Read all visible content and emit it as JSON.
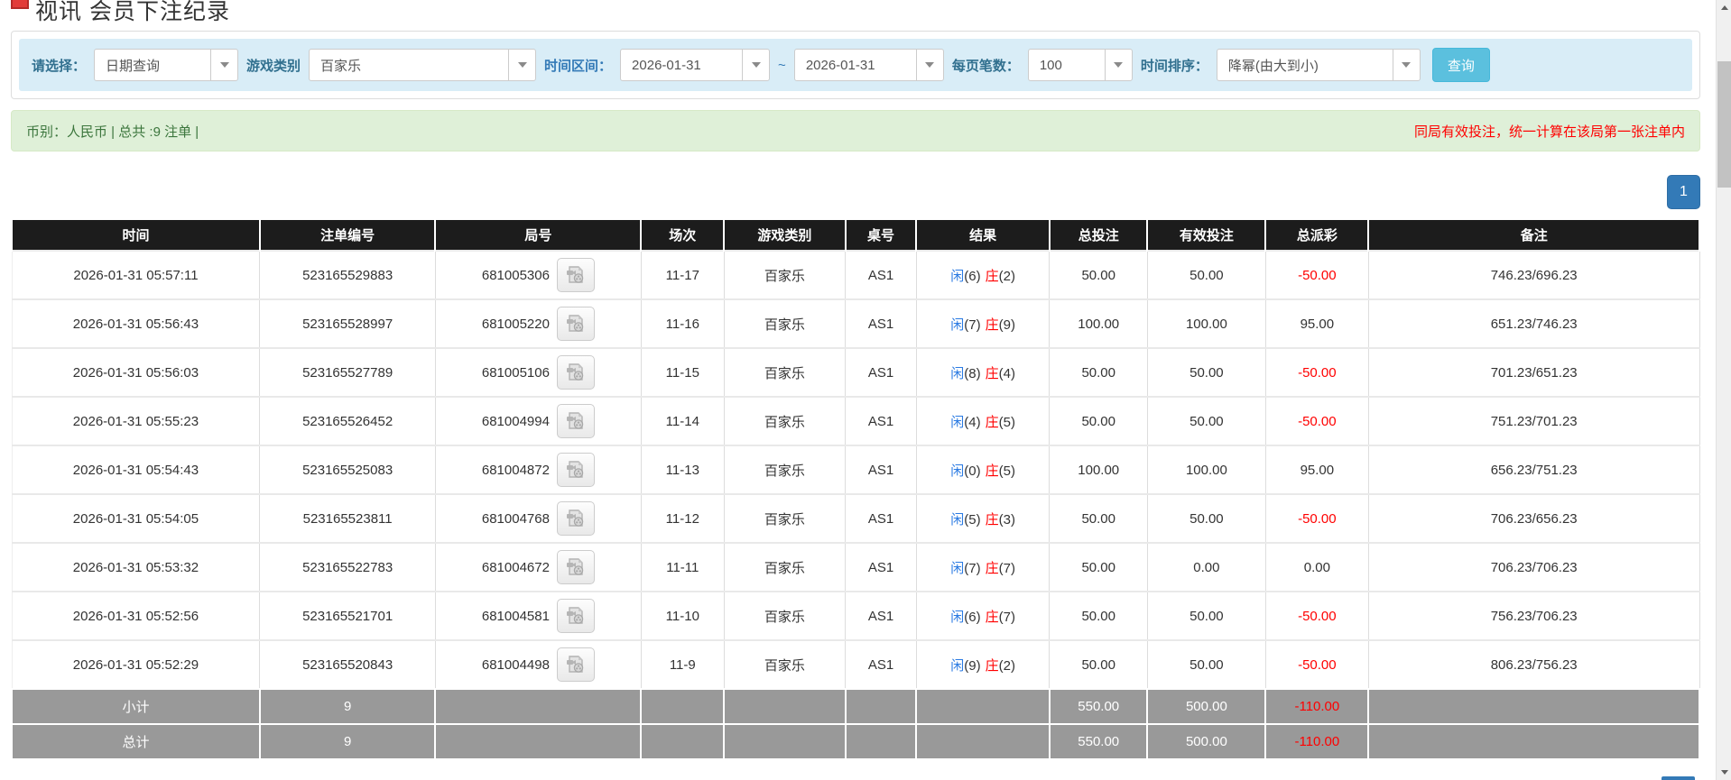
{
  "page": {
    "title": "视讯 会员下注纪录"
  },
  "icons": {
    "top_left": "red-chip-icon",
    "dropdown": "chevron-down-icon",
    "video": "video-replay-icon",
    "scroll_up": "scroll-up-arrow-icon",
    "scroll_down": "scroll-down-arrow-icon"
  },
  "colors": {
    "filter_bar_bg": "#d9edf7",
    "summary_bg": "#dff0d8",
    "summary_text": "#3c763d",
    "note_red": "#ff0000",
    "header_bg": "#1c1c1c",
    "link_blue": "#2a7ae2",
    "accent_blue": "#337ab7",
    "query_btn": "#5bc0de",
    "totals_gray": "#999999"
  },
  "filters": {
    "select_label": "请选择：",
    "select_value": "日期查询",
    "game_label": "游戏类别",
    "game_value": "百家乐",
    "range_label": "时间区间：",
    "date_from": "2026-01-31",
    "range_separator": "~",
    "date_to": "2026-01-31",
    "page_size_label": "每页笔数：",
    "page_size_value": "100",
    "sort_label": "时间排序：",
    "sort_value": "降幂(由大到小)",
    "query_button": "查询"
  },
  "summary": {
    "left": "币别：人民币 | 总共 :9 注单 |",
    "right_note": "同局有效投注，统一计算在该局第一张注单内"
  },
  "pagination": {
    "current": "1"
  },
  "table": {
    "headers": [
      "时间",
      "注单编号",
      "局号",
      "场次",
      "游戏类别",
      "桌号",
      "结果",
      "总投注",
      "有效投注",
      "总派彩",
      "备注"
    ],
    "rows": [
      {
        "time": "2026-01-31 05:57:11",
        "bet_id": "523165529883",
        "round_id": "681005306",
        "session": "11-17",
        "game": "百家乐",
        "table_no": "AS1",
        "result": {
          "player": "闲",
          "player_n": "(6)",
          "banker": "庄",
          "banker_n": "(2)"
        },
        "total_bet": "50.00",
        "valid_bet": "50.00",
        "payout": "-50.00",
        "note": "746.23/696.23"
      },
      {
        "time": "2026-01-31 05:56:43",
        "bet_id": "523165528997",
        "round_id": "681005220",
        "session": "11-16",
        "game": "百家乐",
        "table_no": "AS1",
        "result": {
          "player": "闲",
          "player_n": "(7)",
          "banker": "庄",
          "banker_n": "(9)"
        },
        "total_bet": "100.00",
        "valid_bet": "100.00",
        "payout": "95.00",
        "note": "651.23/746.23"
      },
      {
        "time": "2026-01-31 05:56:03",
        "bet_id": "523165527789",
        "round_id": "681005106",
        "session": "11-15",
        "game": "百家乐",
        "table_no": "AS1",
        "result": {
          "player": "闲",
          "player_n": "(8)",
          "banker": "庄",
          "banker_n": "(4)"
        },
        "total_bet": "50.00",
        "valid_bet": "50.00",
        "payout": "-50.00",
        "note": "701.23/651.23"
      },
      {
        "time": "2026-01-31 05:55:23",
        "bet_id": "523165526452",
        "round_id": "681004994",
        "session": "11-14",
        "game": "百家乐",
        "table_no": "AS1",
        "result": {
          "player": "闲",
          "player_n": "(4)",
          "banker": "庄",
          "banker_n": "(5)"
        },
        "total_bet": "50.00",
        "valid_bet": "50.00",
        "payout": "-50.00",
        "note": "751.23/701.23"
      },
      {
        "time": "2026-01-31 05:54:43",
        "bet_id": "523165525083",
        "round_id": "681004872",
        "session": "11-13",
        "game": "百家乐",
        "table_no": "AS1",
        "result": {
          "player": "闲",
          "player_n": "(0)",
          "banker": "庄",
          "banker_n": "(5)"
        },
        "total_bet": "100.00",
        "valid_bet": "100.00",
        "payout": "95.00",
        "note": "656.23/751.23"
      },
      {
        "time": "2026-01-31 05:54:05",
        "bet_id": "523165523811",
        "round_id": "681004768",
        "session": "11-12",
        "game": "百家乐",
        "table_no": "AS1",
        "result": {
          "player": "闲",
          "player_n": "(5)",
          "banker": "庄",
          "banker_n": "(3)"
        },
        "total_bet": "50.00",
        "valid_bet": "50.00",
        "payout": "-50.00",
        "note": "706.23/656.23"
      },
      {
        "time": "2026-01-31 05:53:32",
        "bet_id": "523165522783",
        "round_id": "681004672",
        "session": "11-11",
        "game": "百家乐",
        "table_no": "AS1",
        "result": {
          "player": "闲",
          "player_n": "(7)",
          "banker": "庄",
          "banker_n": "(7)"
        },
        "total_bet": "50.00",
        "valid_bet": "0.00",
        "payout": "0.00",
        "note": "706.23/706.23"
      },
      {
        "time": "2026-01-31 05:52:56",
        "bet_id": "523165521701",
        "round_id": "681004581",
        "session": "11-10",
        "game": "百家乐",
        "table_no": "AS1",
        "result": {
          "player": "闲",
          "player_n": "(6)",
          "banker": "庄",
          "banker_n": "(7)"
        },
        "total_bet": "50.00",
        "valid_bet": "50.00",
        "payout": "-50.00",
        "note": "756.23/706.23"
      },
      {
        "time": "2026-01-31 05:52:29",
        "bet_id": "523165520843",
        "round_id": "681004498",
        "session": "11-9",
        "game": "百家乐",
        "table_no": "AS1",
        "result": {
          "player": "闲",
          "player_n": "(9)",
          "banker": "庄",
          "banker_n": "(2)"
        },
        "total_bet": "50.00",
        "valid_bet": "50.00",
        "payout": "-50.00",
        "note": "806.23/756.23"
      }
    ],
    "subtotal": {
      "label": "小计",
      "count": "9",
      "total_bet": "550.00",
      "valid_bet": "500.00",
      "payout": "-110.00"
    },
    "total": {
      "label": "总计",
      "count": "9",
      "total_bet": "550.00",
      "valid_bet": "500.00",
      "payout": "-110.00"
    }
  }
}
